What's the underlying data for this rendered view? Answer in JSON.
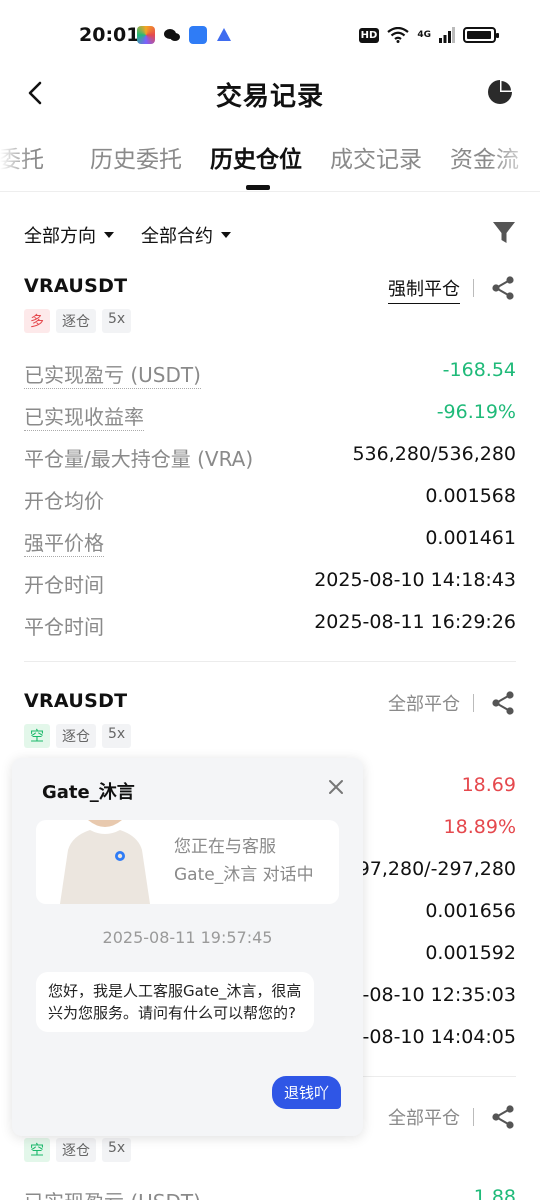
{
  "status_bar": {
    "time": "20:01",
    "hd": "HD",
    "network": "4G"
  },
  "header": {
    "title": "交易记录"
  },
  "tabs": [
    {
      "label": "委托"
    },
    {
      "label": "历史委托"
    },
    {
      "label": "历史仓位"
    },
    {
      "label": "成交记录"
    },
    {
      "label": "资金流"
    }
  ],
  "filters": {
    "direction": "全部方向",
    "contract": "全部合约"
  },
  "positions": [
    {
      "symbol": "VRAUSDT",
      "status": "强制平仓",
      "side": "多",
      "margin_mode": "逐仓",
      "leverage": "5x",
      "rows": [
        {
          "label": "已实现盈亏 (USDT)",
          "value": "-168.54"
        },
        {
          "label": "已实现收益率",
          "value": "-96.19%"
        },
        {
          "label": "平仓量/最大持仓量 (VRA)",
          "value": "536,280/536,280"
        },
        {
          "label": "开仓均价",
          "value": "0.001568"
        },
        {
          "label": "强平价格",
          "value": "0.001461"
        },
        {
          "label": "开仓时间",
          "value": "2025-08-10 14:18:43"
        },
        {
          "label": "平仓时间",
          "value": "2025-08-11 16:29:26"
        }
      ]
    },
    {
      "symbol": "VRAUSDT",
      "status": "全部平仓",
      "side": "空",
      "margin_mode": "逐仓",
      "leverage": "5x",
      "rows": [
        {
          "value": "18.69"
        },
        {
          "value": "18.89%"
        },
        {
          "value": "97,280/-297,280"
        },
        {
          "value": "0.001656"
        },
        {
          "value": "0.001592"
        },
        {
          "value": "-08-10 12:35:03"
        },
        {
          "value": "-08-10 14:04:05"
        }
      ]
    },
    {
      "status": "全部平仓",
      "side": "空",
      "margin_mode": "逐仓",
      "leverage": "5x",
      "rows": [
        {
          "label": "已实现盈亏 (USDT)",
          "value": "1.88"
        }
      ]
    }
  ],
  "chat": {
    "agent_name": "Gate_沐言",
    "intro_line1": "您正在与客服",
    "intro_line2": "Gate_沐言 对话中",
    "timestamp": "2025-08-11 19:57:45",
    "agent_message": "您好，我是人工客服Gate_沐言，很高兴为您服务。请问有什么可以帮您的?",
    "user_message": "退钱吖"
  },
  "colors": {
    "profit_green": "#1fba79",
    "loss_red": "#e5484d",
    "accent_blue": "#2f56e6"
  }
}
